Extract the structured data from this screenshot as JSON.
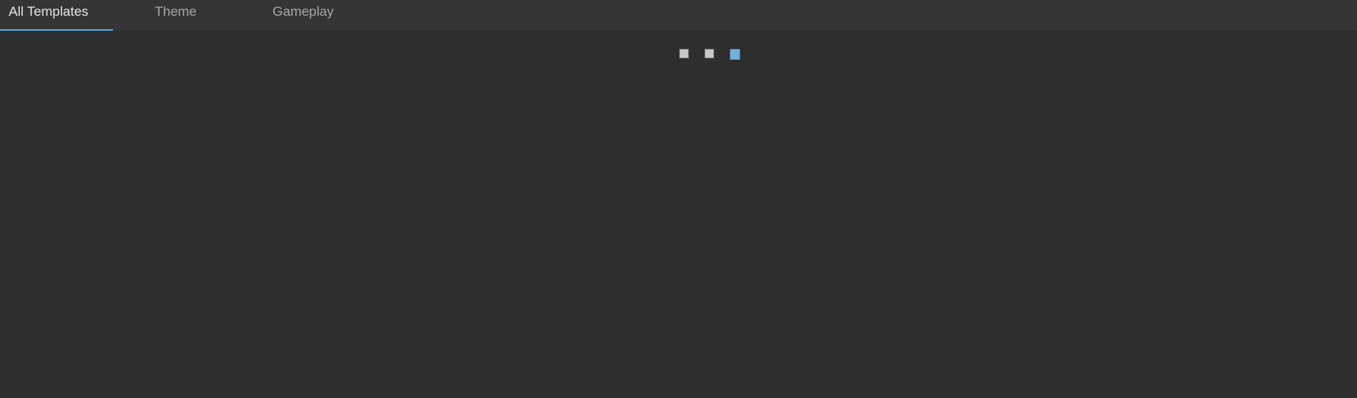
{
  "tabs": [
    {
      "label": "All Templates",
      "active": true
    },
    {
      "label": "Theme",
      "active": false
    },
    {
      "label": "Gameplay",
      "active": false
    }
  ],
  "loader": {
    "dot_count": 3,
    "active_index": 2
  },
  "colors": {
    "background": "#2e2e2e",
    "tabbar": "#353535",
    "accent": "#4fa3d6",
    "active_text": "#e6e6e6",
    "inactive_text": "#a6a6a6",
    "loader_dot": "#c8c8c8",
    "loader_active": "#6fb1d8"
  }
}
